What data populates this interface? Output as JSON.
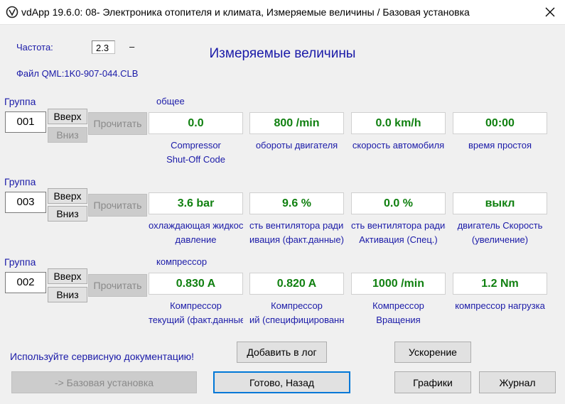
{
  "window": {
    "title": "vdApp 19.6.0: 08- Электроника отопителя и климата,  Измеряемые величины / Базовая установка"
  },
  "header": {
    "freq_label": "Частота:",
    "freq_value": "2.3",
    "freq_unit": "–",
    "file_label": "Файл QML:1K0-907-044.CLB",
    "heading": "Измеряемые величины"
  },
  "groups": [
    {
      "label": "Группа",
      "number": "001",
      "up": "Вверх",
      "down": "Вниз",
      "read": "Прочитать",
      "caption": "общее",
      "values": [
        "0.0",
        "800 /min",
        "0.0 km/h",
        "00:00"
      ],
      "desc": [
        [
          "Compressor",
          "Shut-Off Code"
        ],
        [
          "обороты двигателя",
          ""
        ],
        [
          "скорость автомобиля",
          ""
        ],
        [
          "время простоя",
          ""
        ]
      ]
    },
    {
      "label": "Группа",
      "number": "003",
      "up": "Вверх",
      "down": "Вниз",
      "read": "Прочитать",
      "caption": "",
      "values": [
        "3.6 bar",
        "9.6 %",
        "0.0 %",
        "выкл"
      ],
      "desc": [
        [
          "охлаждающая жидкость",
          "давление"
        ],
        [
          "сть вентилятора радиатора",
          "ивация (факт.данные)"
        ],
        [
          "сть вентилятора радиатора",
          "Активация (Спец.)"
        ],
        [
          "двигатель Скорость",
          "(увеличение)"
        ]
      ]
    },
    {
      "label": "Группа",
      "number": "002",
      "up": "Вверх",
      "down": "Вниз",
      "read": "Прочитать",
      "caption": "компрессор",
      "values": [
        "0.830 A",
        "0.820 A",
        "1000 /min",
        "1.2 Nm"
      ],
      "desc": [
        [
          "Компрессор",
          "текущий (факт.данные)"
        ],
        [
          "Компрессор",
          "ий (специфицированный)"
        ],
        [
          "Компрессор",
          "Вращения"
        ],
        [
          "компрессор нагрузка",
          ""
        ]
      ]
    }
  ],
  "footer": {
    "service_doc": "Используйте сервисную документацию!",
    "add_log": "Добавить в лог",
    "accel": "Ускорение",
    "basic_setting": "-> Базовая установка",
    "done_back": "Готово, Назад",
    "graphs": "Графики",
    "journal": "Журнал"
  },
  "colors": {
    "value_text": "#108010",
    "label_blue": "#1a1aa8",
    "focus_border": "#0078d7"
  }
}
